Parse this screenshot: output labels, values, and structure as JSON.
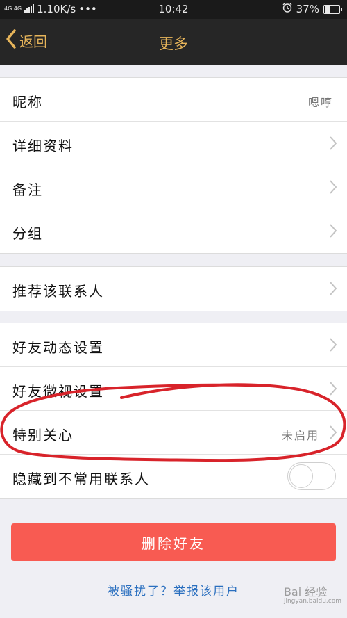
{
  "status_bar": {
    "network_type": "4G 4G",
    "speed": "1.10K/s",
    "more": "•••",
    "time": "10:42",
    "alarm_icon": "alarm-clock-icon",
    "battery": "37%",
    "battery_level": 0.37
  },
  "header": {
    "back_label": "返回",
    "title": "更多"
  },
  "groups": [
    {
      "items": [
        {
          "label": "昵称",
          "value": "嗯哼",
          "chevron": false
        },
        {
          "label": "详细资料",
          "value": "",
          "chevron": true
        },
        {
          "label": "备注",
          "value": "",
          "chevron": true
        },
        {
          "label": "分组",
          "value": "",
          "chevron": true
        }
      ]
    },
    {
      "items": [
        {
          "label": "推荐该联系人",
          "value": "",
          "chevron": true
        }
      ]
    },
    {
      "items": [
        {
          "label": "好友动态设置",
          "value": "",
          "chevron": true
        },
        {
          "label": "好友微视设置",
          "value": "",
          "chevron": true
        },
        {
          "label": "特别关心",
          "value": "未启用",
          "chevron": true
        },
        {
          "label": "隐藏到不常用联系人",
          "value": "",
          "chevron": false,
          "toggle": false
        }
      ]
    }
  ],
  "delete_button": "删除好友",
  "report_link": "被骚扰了？举报该用户",
  "watermark": {
    "text": "Bai 经验",
    "url": "jingyan.baidu.com"
  },
  "colors": {
    "nav_bg": "#262626",
    "accent": "#e6b45a",
    "danger": "#f85b52",
    "link": "#2a6fbf",
    "annotation": "#d8232a"
  }
}
